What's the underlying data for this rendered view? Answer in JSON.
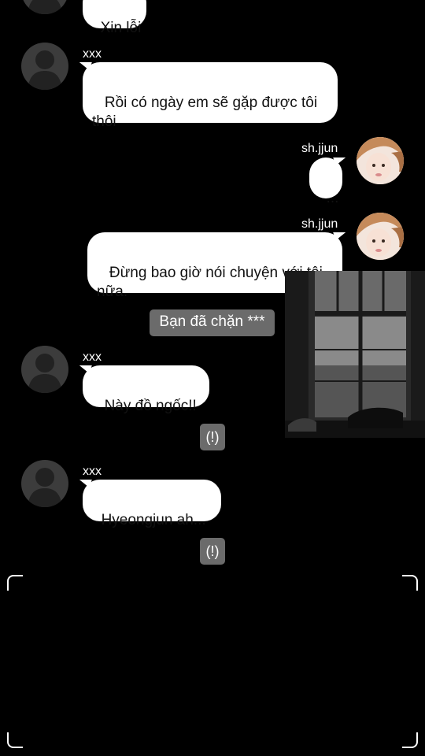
{
  "chat": {
    "messages": [
      {
        "sender": "",
        "text": "Xin lỗi"
      },
      {
        "sender": "xxx",
        "text": " Rồi có ngày em sẽ gặp được tôi\nthôi"
      },
      {
        "sender": "sh.jjun",
        "text": "..."
      },
      {
        "sender": "sh.jjun",
        "text": " Đừng bao giờ nói chuyện với tôi\nnữa."
      },
      {
        "system": "Bạn đã chặn ***"
      },
      {
        "sender": "xxx",
        "text": "Này đồ ngốc!!"
      },
      {
        "alert": "(!)"
      },
      {
        "sender": "xxx",
        "text": "Hyeongjun ah..."
      },
      {
        "alert": "(!)"
      }
    ]
  },
  "icons": {
    "default_avatar": "person-silhouette-icon",
    "failed_send": "exclamation-icon"
  },
  "colors": {
    "background": "#000000",
    "bubble": "#ffffff",
    "system_badge": "#6b6b6b"
  }
}
